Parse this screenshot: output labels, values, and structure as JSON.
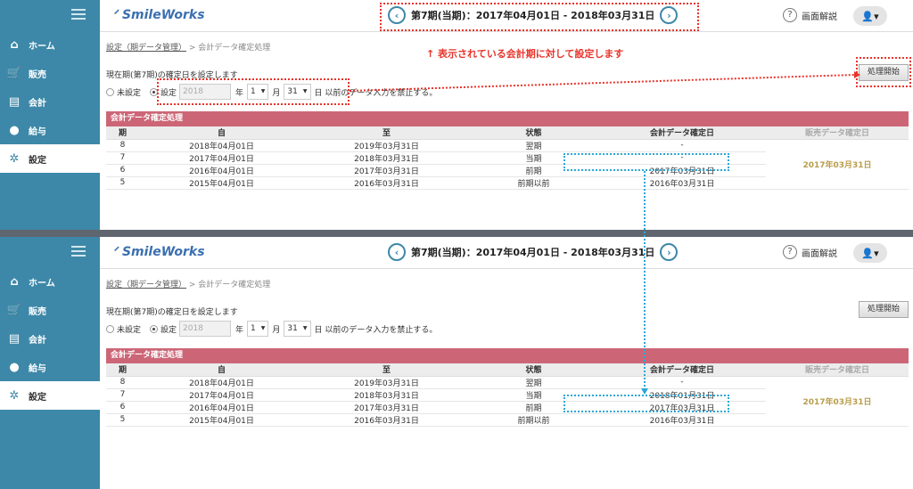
{
  "sidebar": {
    "items": [
      {
        "label": "ホーム",
        "icon": "home-icon",
        "glyph": "⌂"
      },
      {
        "label": "販売",
        "icon": "cart-icon",
        "glyph": "🛒"
      },
      {
        "label": "会計",
        "icon": "calculator-icon",
        "glyph": "▤"
      },
      {
        "label": "給与",
        "icon": "moneybag-icon",
        "glyph": "●"
      },
      {
        "label": "設定",
        "icon": "gear-icon",
        "glyph": "✲"
      }
    ]
  },
  "header": {
    "logo": "SmileWorks",
    "period": "第7期(当期)：2017年04月01日 - 2018年03月31日",
    "prev": "‹",
    "next": "›",
    "help": "画面解説",
    "user_glyph": "👤▾"
  },
  "breadcrumb": {
    "parent": "設定（期データ管理）",
    "sep": " > ",
    "current": "会計データ確定処理"
  },
  "note": "↑ 表示されている会計期に対して設定します",
  "desc": "現在期(第7期)の確定日を設定します",
  "start_button": "処理開始",
  "form": {
    "unset": "未設定",
    "set": "設定",
    "year": "2018",
    "year_unit": "年",
    "month": "1",
    "month_unit": "月",
    "day": "31",
    "day_suffix": "日 以前のデータ入力を禁止する。"
  },
  "table": {
    "title": "会計データ確定処理",
    "headers": [
      "期",
      "自",
      "至",
      "状態",
      "会計データ確定日",
      "販売データ確定日"
    ],
    "sales_date": "2017年03月31日",
    "rows_before": [
      [
        "8",
        "2018年04月01日",
        "2019年03月31日",
        "翌期",
        "-"
      ],
      [
        "7",
        "2017年04月01日",
        "2018年03月31日",
        "当期",
        "-"
      ],
      [
        "6",
        "2016年04月01日",
        "2017年03月31日",
        "前期",
        "2017年03月31日"
      ],
      [
        "5",
        "2015年04月01日",
        "2016年03月31日",
        "前期以前",
        "2016年03月31日"
      ]
    ],
    "rows_after": [
      [
        "8",
        "2018年04月01日",
        "2019年03月31日",
        "翌期",
        "-"
      ],
      [
        "7",
        "2017年04月01日",
        "2018年03月31日",
        "当期",
        "2018年01月31日"
      ],
      [
        "6",
        "2016年04月01日",
        "2017年03月31日",
        "前期",
        "2017年03月31日"
      ],
      [
        "5",
        "2015年04月01日",
        "2016年03月31日",
        "前期以前",
        "2016年03月31日"
      ]
    ]
  },
  "colors": {
    "sidebar": "#3d88a8",
    "table_title": "#cc6677",
    "annotation_red": "#e8332a",
    "annotation_blue": "#2aa7d9"
  }
}
